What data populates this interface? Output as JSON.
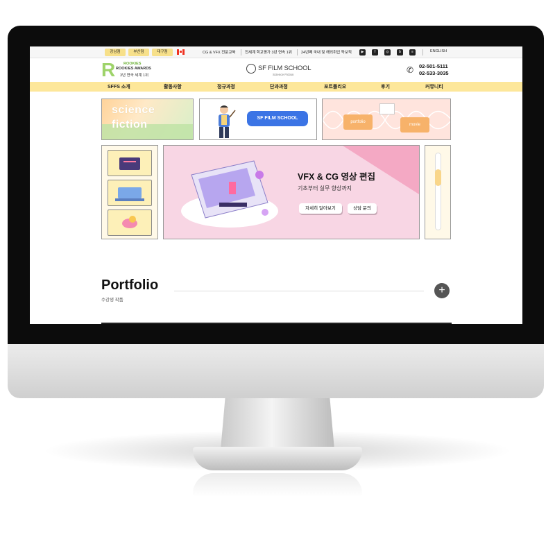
{
  "topbar": {
    "branches": [
      "강남점",
      "부산점",
      "대구점"
    ],
    "notices": [
      "CG & VFX  전문교육",
      "전세계 학교평가 3년 연속 1위",
      "24년째 국내 및 해외취업 독보적"
    ],
    "social_icons": [
      "youtube-icon",
      "facebook-icon",
      "instagram-icon",
      "blog-icon",
      "notebook-icon"
    ],
    "language": "ENGLISH"
  },
  "header": {
    "awards_brand": "ROOKIES AWARDS",
    "awards_tag": "ROOKIES",
    "awards_desc": "3년 연속 세계 1위",
    "school_name": "SF FILM SCHOOL",
    "school_sub": "Science Fiction",
    "phones": [
      "02-501-5111",
      "02-533-3035"
    ]
  },
  "nav": [
    "SFFS 소개",
    "활동사항",
    "정규과정",
    "단과과정",
    "포트폴리오",
    "후기",
    "커뮤니티"
  ],
  "cards": {
    "science_line1": "science",
    "science_line2": "fiction",
    "school_button": "SF FILM SCHOOL",
    "folder_portfolio": "portfolio",
    "folder_movie": "movie"
  },
  "hero": {
    "title": "VFX & CG 영상 편집",
    "subtitle": "기초부터 실무 향상까지",
    "btn_more": "자세히 알아보기",
    "btn_consult": "상담 문의"
  },
  "portfolio": {
    "title": "Portfolio",
    "subtitle": "수강생 작품",
    "plus": "+"
  },
  "colors": {
    "nav_bg": "#fde79a",
    "hero_bg": "#f8d6e4",
    "accent_blue": "#3b74e5",
    "awards_green": "#9ed36a"
  }
}
